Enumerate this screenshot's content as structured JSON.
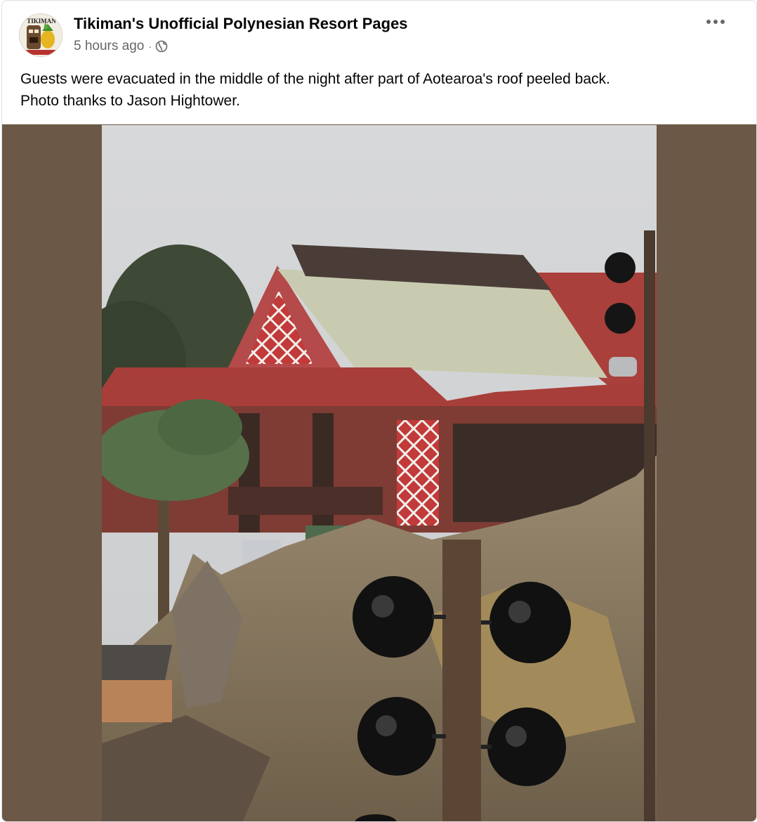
{
  "post": {
    "page_name": "Tikiman's Unofficial Polynesian Resort Pages",
    "timestamp": "5 hours ago",
    "separator": "·",
    "audience_icon": "globe-icon",
    "more_icon": "more-options-icon",
    "text_line1": "Guests were evacuated in the middle of the night after part of Aotearoa's roof peeled back.",
    "text_line2": "Photo thanks to Jason Hightower.",
    "avatar_logo_text": "TIKIMAN"
  },
  "colors": {
    "media_background": "#6b5846",
    "secondary_text": "#65676b",
    "primary_text": "#050505"
  }
}
